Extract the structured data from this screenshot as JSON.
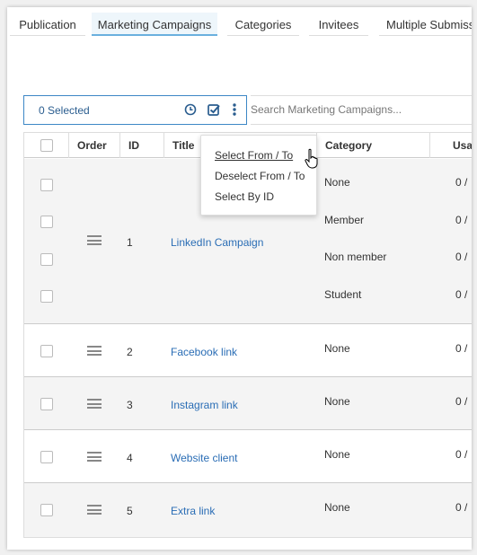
{
  "tabs": [
    {
      "label": "Publication",
      "active": false
    },
    {
      "label": "Marketing Campaigns",
      "active": true
    },
    {
      "label": "Categories",
      "active": false
    },
    {
      "label": "Invitees",
      "active": false
    },
    {
      "label": "Multiple Submiss",
      "active": false
    }
  ],
  "toolbar": {
    "selected_text": "0 Selected",
    "icons": [
      "clock-icon",
      "check-square-icon",
      "kebab-menu-icon"
    ]
  },
  "search": {
    "placeholder": "Search Marketing Campaigns..."
  },
  "table": {
    "columns": [
      "Order",
      "ID",
      "Title",
      "Category",
      "Usa"
    ],
    "rows": [
      {
        "id": "1",
        "title": "LinkedIn Campaign",
        "categories": [
          {
            "name": "None",
            "usage": "0 /"
          },
          {
            "name": "Member",
            "usage": "0 /"
          },
          {
            "name": "Non member",
            "usage": "0 /"
          },
          {
            "name": "Student",
            "usage": "0 /"
          }
        ]
      },
      {
        "id": "2",
        "title": "Facebook link",
        "categories": [
          {
            "name": "None",
            "usage": "0 /"
          }
        ]
      },
      {
        "id": "3",
        "title": "Instagram link",
        "categories": [
          {
            "name": "None",
            "usage": "0 /"
          }
        ]
      },
      {
        "id": "4",
        "title": "Website client",
        "categories": [
          {
            "name": "None",
            "usage": "0 /"
          }
        ]
      },
      {
        "id": "5",
        "title": "Extra link",
        "categories": [
          {
            "name": "None",
            "usage": "0 /"
          }
        ]
      }
    ]
  },
  "menu": {
    "items": [
      "Select From / To",
      "Deselect From / To",
      "Select By ID"
    ],
    "hovered": "Select From / To"
  },
  "colors": {
    "accent": "#3d87c6",
    "link": "#2a6db5",
    "active_tab_bg": "#eef6fb"
  }
}
